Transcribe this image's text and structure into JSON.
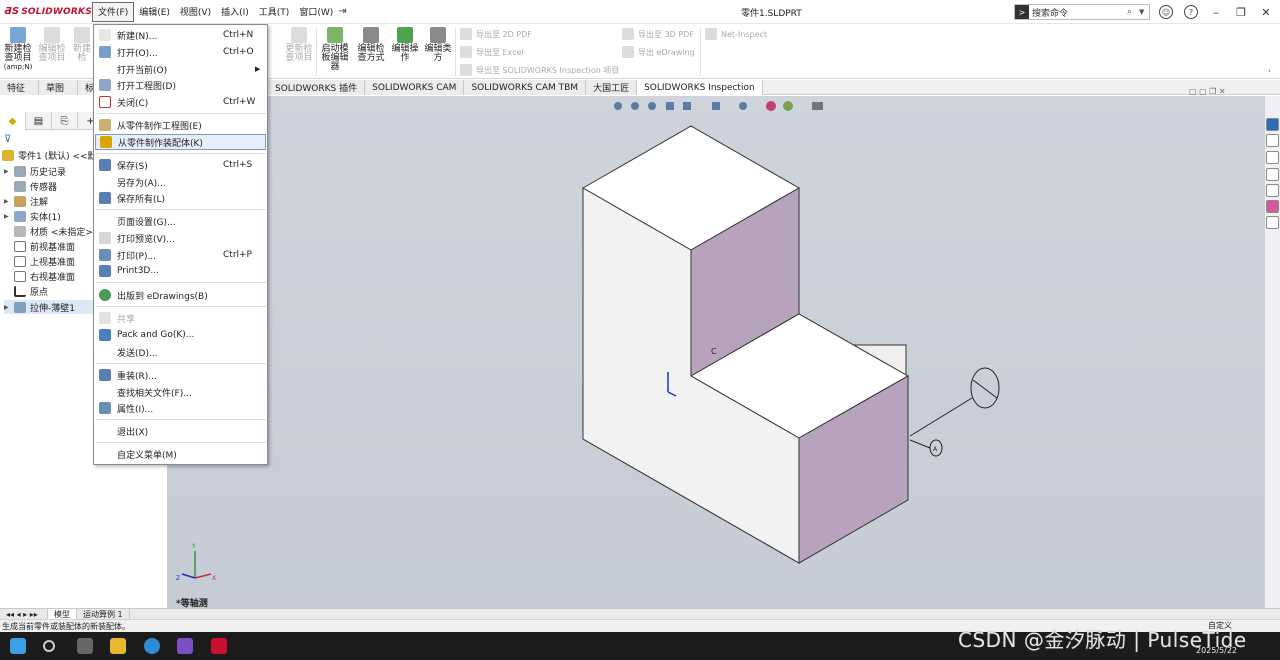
{
  "app": {
    "logo_text": "SOLIDWORKS",
    "doc_title": "零件1.SLDPRT",
    "menus": [
      "文件(F)",
      "编辑(E)",
      "视图(V)",
      "插入(I)",
      "工具(T)",
      "窗口(W)"
    ],
    "search_placeholder": "搜索命令"
  },
  "ribbon": {
    "buttons": [
      {
        "label": "新建检查项目",
        "sub": "(amp;N)"
      },
      {
        "label": "编辑检查项目"
      },
      {
        "label": "新建检"
      },
      {
        "label": "更新检查项目"
      },
      {
        "label": "启动模板编辑器"
      },
      {
        "label": "编辑检查方式"
      },
      {
        "label": "编辑操作"
      },
      {
        "label": "编辑类方"
      }
    ],
    "exports": [
      "导出至 2D PDF",
      "导出至 Excel",
      "导出至 SOLIDWORKS Inspection 项目",
      "导出至 3D PDF",
      "导出 eDrawing",
      "Net-Inspect"
    ]
  },
  "command_tabs": [
    "特征",
    "草图",
    "标",
    "SOLIDWORKS 插件",
    "SOLIDWORKS CAM",
    "SOLIDWORKS CAM TBM",
    "大国工匠",
    "SOLIDWORKS Inspection"
  ],
  "tree": {
    "root": "零件1 (默认) <<默认",
    "items": [
      "历史记录",
      "传感器",
      "注解",
      "实体(1)",
      "材质 <未指定>",
      "前视基准面",
      "上视基准面",
      "右视基准面",
      "原点",
      "拉伸-薄壁1"
    ]
  },
  "file_menu": {
    "items": [
      {
        "label": "新建(N)...",
        "shortcut": "Ctrl+N"
      },
      {
        "label": "打开(O)...",
        "shortcut": "Ctrl+O"
      },
      {
        "label": "打开当前(O)"
      },
      {
        "label": "打开工程图(D)"
      },
      {
        "label": "关闭(C)",
        "shortcut": "Ctrl+W"
      },
      {
        "label": "从零件制作工程图(E)"
      },
      {
        "label": "从零件制作装配体(K)"
      },
      {
        "label": "保存(S)",
        "shortcut": "Ctrl+S"
      },
      {
        "label": "另存为(A)..."
      },
      {
        "label": "保存所有(L)"
      },
      {
        "label": "页面设置(G)..."
      },
      {
        "label": "打印预览(V)..."
      },
      {
        "label": "打印(P)...",
        "shortcut": "Ctrl+P"
      },
      {
        "label": "Print3D..."
      },
      {
        "label": "出版到 eDrawings(B)"
      },
      {
        "label": "共享"
      },
      {
        "label": "Pack and Go(K)..."
      },
      {
        "label": "发送(D)..."
      },
      {
        "label": "重装(R)..."
      },
      {
        "label": "查找相关文件(F)..."
      },
      {
        "label": "属性(I)..."
      },
      {
        "label": "退出(X)"
      },
      {
        "label": "自定义菜单(M)"
      }
    ]
  },
  "graphics": {
    "view_label": "*等轴测",
    "note_c": "C",
    "note_a": "A"
  },
  "bottom_tabs": [
    "模型",
    "运动算例 1"
  ],
  "status": {
    "message": "生成当前零件或装配体的新装配体。",
    "right": "自定义"
  },
  "taskbar": {
    "date": "2025/5/22",
    "watermark": "CSDN @金汐脉动 | PulseTide"
  },
  "colors": {
    "accent_red": "#c8102e",
    "face_purple": "#b7a3bb",
    "face_light": "#f2f2f2",
    "background": "#cbd0d9"
  }
}
